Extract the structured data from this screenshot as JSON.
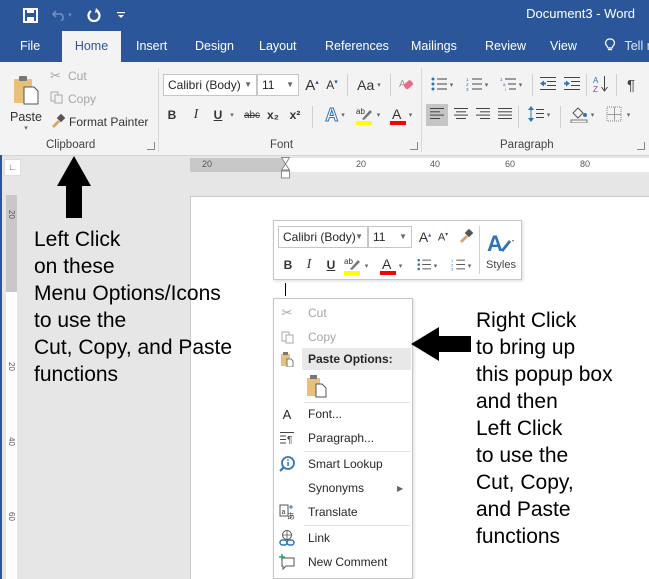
{
  "window": {
    "title": "Document3  -  Word"
  },
  "quick_access": {
    "save": "save-icon",
    "undo": "undo-icon",
    "redo": "redo-icon",
    "customize": "customize-icon"
  },
  "tabs": [
    {
      "label": "File",
      "active": false
    },
    {
      "label": "Home",
      "active": true
    },
    {
      "label": "Insert",
      "active": false
    },
    {
      "label": "Design",
      "active": false
    },
    {
      "label": "Layout",
      "active": false
    },
    {
      "label": "References",
      "active": false
    },
    {
      "label": "Mailings",
      "active": false
    },
    {
      "label": "Review",
      "active": false
    },
    {
      "label": "View",
      "active": false
    },
    {
      "label": "Tell me",
      "active": false
    }
  ],
  "ribbon": {
    "clipboard": {
      "label": "Clipboard",
      "paste": "Paste",
      "cut": "Cut",
      "copy": "Copy",
      "format_painter": "Format Painter"
    },
    "font": {
      "label": "Font",
      "font_name": "Calibri (Body)",
      "font_size": "11",
      "bold": "B",
      "italic": "I",
      "underline": "U",
      "strikethrough": "abc",
      "subscript": "x₂",
      "superscript": "x²",
      "change_case": "Aa",
      "highlight_color": "#ffff00",
      "font_color": "#ff0000"
    },
    "paragraph": {
      "label": "Paragraph"
    }
  },
  "rulers": {
    "horizontal_ticks": [
      "20",
      "20",
      "40",
      "60",
      "80"
    ],
    "vertical_ticks": [
      "20",
      "20",
      "40",
      "60"
    ]
  },
  "mini_toolbar": {
    "font_name": "Calibri (Body)",
    "font_size": "11",
    "bold": "B",
    "italic": "I",
    "underline": "U",
    "styles": "Styles"
  },
  "context_menu": {
    "items": [
      {
        "label": "Cut",
        "icon": "scissors-icon",
        "disabled": true
      },
      {
        "label": "Copy",
        "icon": "copy-icon",
        "disabled": true
      },
      {
        "label": "Paste Options:",
        "icon": "paste-icon",
        "header": true
      },
      {
        "label": "Font...",
        "icon": "font-icon"
      },
      {
        "label": "Paragraph...",
        "icon": "paragraph-icon"
      },
      {
        "label": "Smart Lookup",
        "icon": "smart-lookup-icon"
      },
      {
        "label": "Synonyms",
        "icon": "",
        "submenu": true
      },
      {
        "label": "Translate",
        "icon": "translate-icon"
      },
      {
        "label": "Link",
        "icon": "link-icon"
      },
      {
        "label": "New Comment",
        "icon": "new-comment-icon"
      }
    ]
  },
  "annotations": {
    "left": "Left Click\non these\nMenu Options/Icons\nto use the\nCut, Copy, and Paste\nfunctions",
    "right": "Right Click\nto bring up\nthis popup box\nand then\nLeft Click\nto use the\nCut, Copy,\nand Paste\nfunctions"
  }
}
